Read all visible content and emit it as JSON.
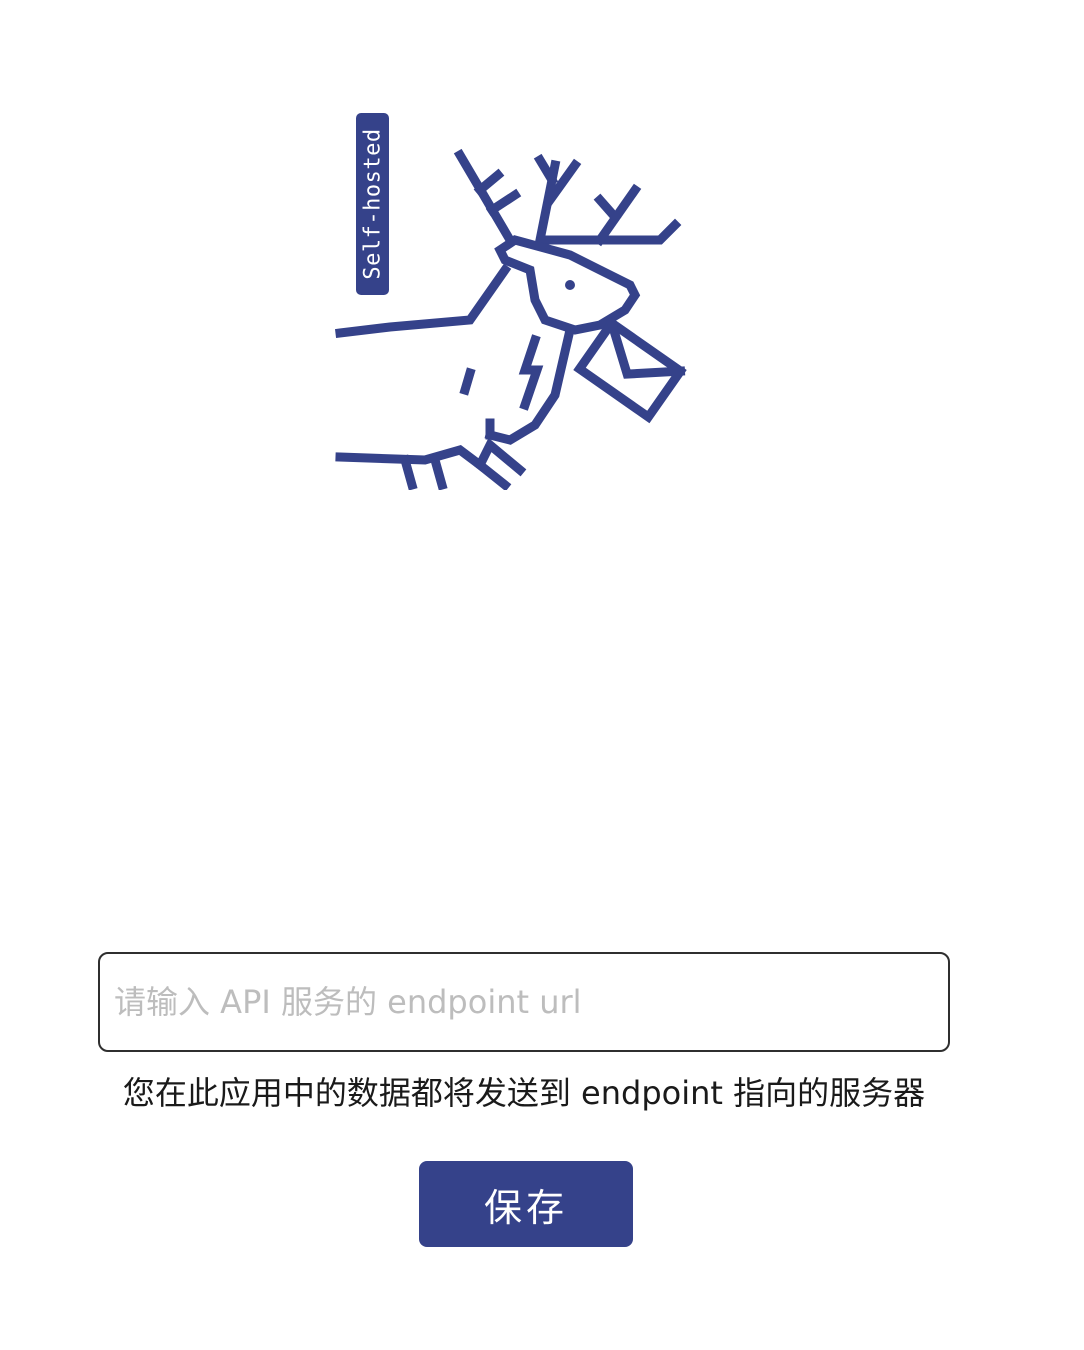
{
  "logo": {
    "badge_text": "Self-hosted",
    "icon": "reindeer-with-envelope-icon",
    "color": "#35428a"
  },
  "form": {
    "endpoint_placeholder": "请输入 API 服务的 endpoint url",
    "endpoint_value": "",
    "hint": "您在此应用中的数据都将发送到 endpoint 指向的服务器",
    "save_label": "保存"
  },
  "colors": {
    "accent": "#35428a",
    "placeholder": "#bdbdbd",
    "border": "#2f2f2f"
  }
}
